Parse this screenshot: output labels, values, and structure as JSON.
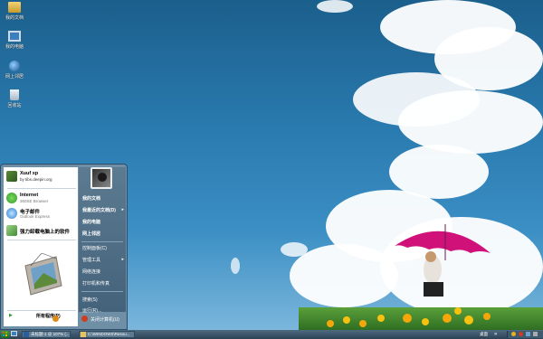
{
  "desktop": {
    "icons": [
      {
        "label": "我的文档",
        "icon": "folder-documents-icon"
      },
      {
        "label": "我的电脑",
        "icon": "computer-icon"
      },
      {
        "label": "网上邻居",
        "icon": "network-icon"
      },
      {
        "label": "回收站",
        "icon": "recycle-bin-icon"
      }
    ]
  },
  "start_menu": {
    "user": {
      "name": "Xuuf xp",
      "subtitle": "by tibs.deepin.org"
    },
    "pinned": [
      {
        "title": "Internet",
        "subtitle": "360SE Browser",
        "icon": "internet-browser-icon"
      },
      {
        "title": "电子邮件",
        "subtitle": "Outlook Express",
        "icon": "email-icon"
      },
      {
        "title": "强力卸载电脑上的软件",
        "subtitle": "",
        "icon": "uninstall-icon"
      }
    ],
    "all_programs": "所有程序(P)",
    "right": {
      "group1": [
        {
          "label": "我的文档",
          "arrow": false
        },
        {
          "label": "我最近的文档(D)",
          "arrow": true
        },
        {
          "label": "我的电脑",
          "arrow": false
        },
        {
          "label": "网上邻居",
          "arrow": false
        }
      ],
      "group2": [
        {
          "label": "控制面板(C)",
          "arrow": false
        },
        {
          "label": "管理工具",
          "arrow": true
        },
        {
          "label": "网络连接",
          "arrow": false
        },
        {
          "label": "打印机和传真",
          "arrow": false
        }
      ],
      "group3": [
        {
          "label": "搜索(S)",
          "arrow": false
        },
        {
          "label": "运行(R)...",
          "arrow": false
        }
      ]
    },
    "logoff": "注销(L)",
    "shutdown": "关闭计算机(U)"
  },
  "taskbar": {
    "buttons": [
      {
        "label": "未标题-1 @ 107% (...",
        "icon": "photoshop-icon"
      },
      {
        "label": "C:\\WINDOWS\\Resou...",
        "icon": "folder-icon"
      }
    ],
    "tray_label": "桌面",
    "arrow": "»"
  },
  "colors": {
    "accent_green": "#2e9a2e",
    "shutdown_red": "#d23c1e",
    "logoff_orange": "#e08a1a"
  }
}
